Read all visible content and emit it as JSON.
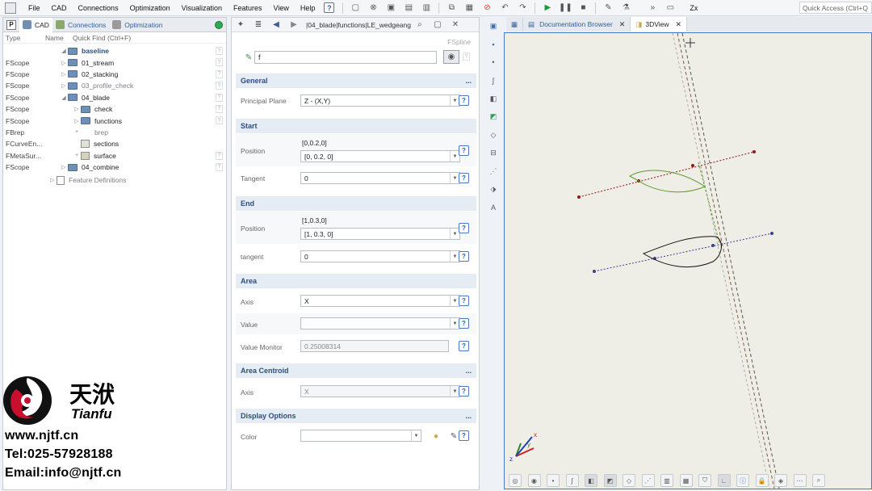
{
  "menubar": {
    "items": [
      "File",
      "CAD",
      "Connections",
      "Optimization",
      "Visualization",
      "Features",
      "View",
      "Help"
    ],
    "zoom_label": "Zx",
    "quick_access_placeholder": "Quick Access (Ctrl+Q"
  },
  "left_panel": {
    "tabs": [
      "CAD",
      "Connections",
      "Optimization"
    ],
    "columns": {
      "type": "Type",
      "name": "Name",
      "quick_find": "Quick Find (Ctrl+F)"
    },
    "root": "baseline",
    "rows": [
      {
        "type": "FScope",
        "name": "01_stream"
      },
      {
        "type": "FScope",
        "name": "02_stacking"
      },
      {
        "type": "FScope",
        "name": "03_profile_check"
      },
      {
        "type": "FScope",
        "name": "04_blade"
      },
      {
        "type": "FScope",
        "name": "check"
      },
      {
        "type": "FScope",
        "name": "functions"
      },
      {
        "type": "FBrep",
        "name": "brep"
      },
      {
        "type": "FCurveEn...",
        "name": "sections"
      },
      {
        "type": "FMetaSur...",
        "name": "surface"
      },
      {
        "type": "FScope",
        "name": "04_combine"
      }
    ],
    "feature_definitions": "Feature Definitions"
  },
  "mid_panel": {
    "path": "|04_blade|functions|LE_wedgeang",
    "class_label": "FSpline",
    "name_value": "f",
    "sections": {
      "general": "General",
      "start": "Start",
      "end": "End",
      "area": "Area",
      "area_centroid": "Area Centroid",
      "display_options": "Display Options"
    },
    "general": {
      "plane_label": "Principal Plane",
      "plane_value": "Z - (X,Y)"
    },
    "start": {
      "position_label": "Position",
      "position_text": "[0,0.2,0]",
      "position_value": "[0, 0.2, 0]",
      "tangent_label": "Tangent",
      "tangent_value": "0"
    },
    "end": {
      "position_label": "Position",
      "position_text": "[1,0.3,0]",
      "position_value": "[1, 0.3, 0]",
      "tangent_label": "tangent",
      "tangent_value": "0"
    },
    "area": {
      "axis_label": "Axis",
      "axis_value": "X",
      "value_label": "Value",
      "value_value": "",
      "monitor_label": "Value Monitor",
      "monitor_value": "0.25008314"
    },
    "area_centroid": {
      "axis_label": "Axis",
      "axis_value": "X"
    },
    "display": {
      "color_label": "Color"
    },
    "help_glyph": "?",
    "more_glyph": "..."
  },
  "view": {
    "tabs": [
      "Documentation Browser",
      "3DView"
    ],
    "axis_labels": {
      "x": "x",
      "y": "y",
      "z": "z"
    }
  },
  "watermark": {
    "brand_cn": "天洑",
    "brand_en": "Tianfu",
    "website": "www.njtf.cn",
    "tel": "Tel:025-57928188",
    "email": "Email:info@njtf.cn"
  },
  "colors": {
    "accent": "#4a79c9",
    "section_bg": "#e6ecf4",
    "curve_red": "#8b1a1a",
    "curve_blue": "#3b3f8f",
    "curve_green": "#5a9b2a"
  }
}
